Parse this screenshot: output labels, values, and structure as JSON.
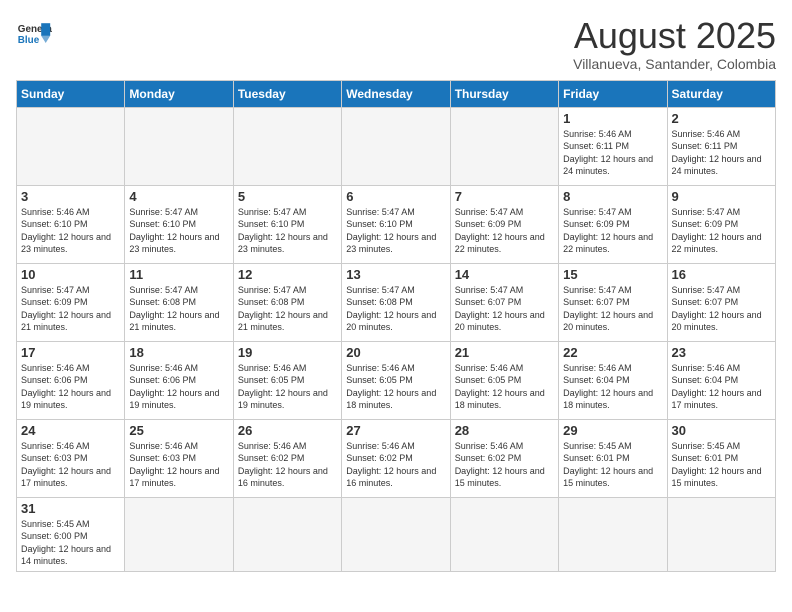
{
  "header": {
    "logo_general": "General",
    "logo_blue": "Blue",
    "title": "August 2025",
    "subtitle": "Villanueva, Santander, Colombia"
  },
  "days_of_week": [
    "Sunday",
    "Monday",
    "Tuesday",
    "Wednesday",
    "Thursday",
    "Friday",
    "Saturday"
  ],
  "weeks": [
    [
      {
        "day": "",
        "info": "",
        "empty": true
      },
      {
        "day": "",
        "info": "",
        "empty": true
      },
      {
        "day": "",
        "info": "",
        "empty": true
      },
      {
        "day": "",
        "info": "",
        "empty": true
      },
      {
        "day": "",
        "info": "",
        "empty": true
      },
      {
        "day": "1",
        "info": "Sunrise: 5:46 AM\nSunset: 6:11 PM\nDaylight: 12 hours\nand 24 minutes."
      },
      {
        "day": "2",
        "info": "Sunrise: 5:46 AM\nSunset: 6:11 PM\nDaylight: 12 hours\nand 24 minutes."
      }
    ],
    [
      {
        "day": "3",
        "info": "Sunrise: 5:46 AM\nSunset: 6:10 PM\nDaylight: 12 hours\nand 23 minutes."
      },
      {
        "day": "4",
        "info": "Sunrise: 5:47 AM\nSunset: 6:10 PM\nDaylight: 12 hours\nand 23 minutes."
      },
      {
        "day": "5",
        "info": "Sunrise: 5:47 AM\nSunset: 6:10 PM\nDaylight: 12 hours\nand 23 minutes."
      },
      {
        "day": "6",
        "info": "Sunrise: 5:47 AM\nSunset: 6:10 PM\nDaylight: 12 hours\nand 23 minutes."
      },
      {
        "day": "7",
        "info": "Sunrise: 5:47 AM\nSunset: 6:09 PM\nDaylight: 12 hours\nand 22 minutes."
      },
      {
        "day": "8",
        "info": "Sunrise: 5:47 AM\nSunset: 6:09 PM\nDaylight: 12 hours\nand 22 minutes."
      },
      {
        "day": "9",
        "info": "Sunrise: 5:47 AM\nSunset: 6:09 PM\nDaylight: 12 hours\nand 22 minutes."
      }
    ],
    [
      {
        "day": "10",
        "info": "Sunrise: 5:47 AM\nSunset: 6:09 PM\nDaylight: 12 hours\nand 21 minutes."
      },
      {
        "day": "11",
        "info": "Sunrise: 5:47 AM\nSunset: 6:08 PM\nDaylight: 12 hours\nand 21 minutes."
      },
      {
        "day": "12",
        "info": "Sunrise: 5:47 AM\nSunset: 6:08 PM\nDaylight: 12 hours\nand 21 minutes."
      },
      {
        "day": "13",
        "info": "Sunrise: 5:47 AM\nSunset: 6:08 PM\nDaylight: 12 hours\nand 20 minutes."
      },
      {
        "day": "14",
        "info": "Sunrise: 5:47 AM\nSunset: 6:07 PM\nDaylight: 12 hours\nand 20 minutes."
      },
      {
        "day": "15",
        "info": "Sunrise: 5:47 AM\nSunset: 6:07 PM\nDaylight: 12 hours\nand 20 minutes."
      },
      {
        "day": "16",
        "info": "Sunrise: 5:47 AM\nSunset: 6:07 PM\nDaylight: 12 hours\nand 20 minutes."
      }
    ],
    [
      {
        "day": "17",
        "info": "Sunrise: 5:46 AM\nSunset: 6:06 PM\nDaylight: 12 hours\nand 19 minutes."
      },
      {
        "day": "18",
        "info": "Sunrise: 5:46 AM\nSunset: 6:06 PM\nDaylight: 12 hours\nand 19 minutes."
      },
      {
        "day": "19",
        "info": "Sunrise: 5:46 AM\nSunset: 6:05 PM\nDaylight: 12 hours\nand 19 minutes."
      },
      {
        "day": "20",
        "info": "Sunrise: 5:46 AM\nSunset: 6:05 PM\nDaylight: 12 hours\nand 18 minutes."
      },
      {
        "day": "21",
        "info": "Sunrise: 5:46 AM\nSunset: 6:05 PM\nDaylight: 12 hours\nand 18 minutes."
      },
      {
        "day": "22",
        "info": "Sunrise: 5:46 AM\nSunset: 6:04 PM\nDaylight: 12 hours\nand 18 minutes."
      },
      {
        "day": "23",
        "info": "Sunrise: 5:46 AM\nSunset: 6:04 PM\nDaylight: 12 hours\nand 17 minutes."
      }
    ],
    [
      {
        "day": "24",
        "info": "Sunrise: 5:46 AM\nSunset: 6:03 PM\nDaylight: 12 hours\nand 17 minutes."
      },
      {
        "day": "25",
        "info": "Sunrise: 5:46 AM\nSunset: 6:03 PM\nDaylight: 12 hours\nand 17 minutes."
      },
      {
        "day": "26",
        "info": "Sunrise: 5:46 AM\nSunset: 6:02 PM\nDaylight: 12 hours\nand 16 minutes."
      },
      {
        "day": "27",
        "info": "Sunrise: 5:46 AM\nSunset: 6:02 PM\nDaylight: 12 hours\nand 16 minutes."
      },
      {
        "day": "28",
        "info": "Sunrise: 5:46 AM\nSunset: 6:02 PM\nDaylight: 12 hours\nand 15 minutes."
      },
      {
        "day": "29",
        "info": "Sunrise: 5:45 AM\nSunset: 6:01 PM\nDaylight: 12 hours\nand 15 minutes."
      },
      {
        "day": "30",
        "info": "Sunrise: 5:45 AM\nSunset: 6:01 PM\nDaylight: 12 hours\nand 15 minutes."
      }
    ],
    [
      {
        "day": "31",
        "info": "Sunrise: 5:45 AM\nSunset: 6:00 PM\nDaylight: 12 hours\nand 14 minutes."
      },
      {
        "day": "",
        "info": "",
        "empty": true
      },
      {
        "day": "",
        "info": "",
        "empty": true
      },
      {
        "day": "",
        "info": "",
        "empty": true
      },
      {
        "day": "",
        "info": "",
        "empty": true
      },
      {
        "day": "",
        "info": "",
        "empty": true
      },
      {
        "day": "",
        "info": "",
        "empty": true
      }
    ]
  ]
}
